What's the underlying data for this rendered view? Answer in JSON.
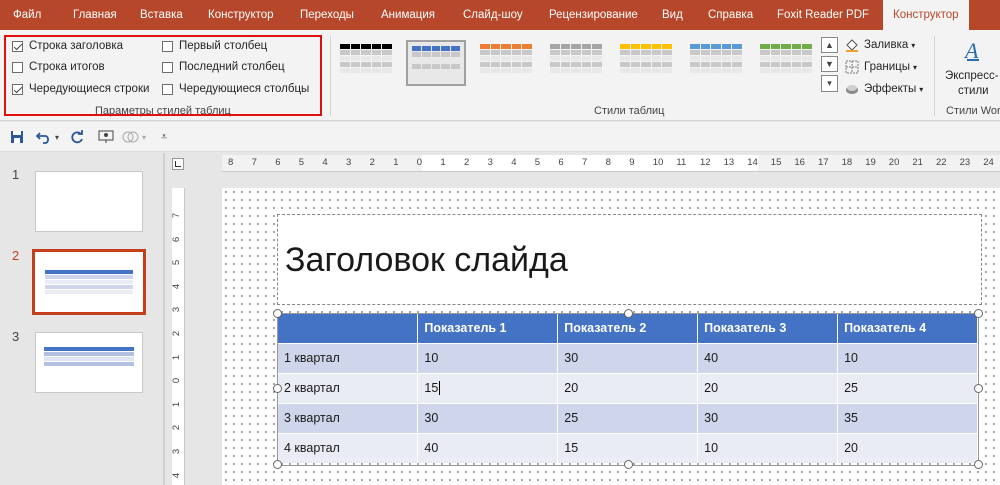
{
  "ribbon_tabs": [
    "Файл",
    "Главная",
    "Вставка",
    "Конструктор",
    "Переходы",
    "Анимация",
    "Слайд-шоу",
    "Рецензирование",
    "Вид",
    "Справка",
    "Foxit Reader PDF",
    "Конструктор"
  ],
  "active_tab_index": 11,
  "table_style_options": {
    "group_label": "Параметры стилей таблиц",
    "options": [
      {
        "label": "Строка заголовка",
        "checked": true
      },
      {
        "label": "Строка итогов",
        "checked": false
      },
      {
        "label": "Чередующиеся строки",
        "checked": true
      },
      {
        "label": "Первый столбец",
        "checked": false
      },
      {
        "label": "Последний столбец",
        "checked": false
      },
      {
        "label": "Чередующиеся столбцы",
        "checked": false
      }
    ]
  },
  "table_styles": {
    "group_label": "Стили таблиц",
    "thumb_colors": [
      "#000000",
      "#4472c4",
      "#ed7d31",
      "#a5a5a5",
      "#ffc000",
      "#5b9bd5",
      "#70ad47"
    ],
    "selected_index": 1
  },
  "shading": {
    "fill_label": "Заливка",
    "borders_label": "Границы",
    "effects_label": "Эффекты"
  },
  "wordart": {
    "express_label": "Экспресс-",
    "express_label2": "стили",
    "group_label": "Стили Wor"
  },
  "ruler_h_labels": [
    "8",
    "7",
    "6",
    "5",
    "4",
    "3",
    "2",
    "1",
    "0",
    "1",
    "2",
    "3",
    "4",
    "5",
    "6",
    "7",
    "8",
    "9",
    "10",
    "11",
    "12",
    "13",
    "14",
    "15",
    "16",
    "17",
    "18",
    "19",
    "20",
    "21",
    "22",
    "23",
    "24"
  ],
  "ruler_v_labels": [
    "7",
    "6",
    "5",
    "4",
    "3",
    "2",
    "1",
    "0",
    "1",
    "2",
    "3",
    "4"
  ],
  "thumbnails": [
    {
      "number": "1",
      "active": false
    },
    {
      "number": "2",
      "active": true
    },
    {
      "number": "3",
      "active": false
    }
  ],
  "slide": {
    "title": "Заголовок слайда",
    "table": {
      "headers": [
        "",
        "Показатель 1",
        "Показатель 2",
        "Показатель 3",
        "Показатель 4"
      ],
      "rows": [
        [
          "1 квартал",
          "10",
          "30",
          "40",
          "10"
        ],
        [
          "2 квартал",
          "15",
          "20",
          "20",
          "25"
        ],
        [
          "3 квартал",
          "30",
          "25",
          "30",
          "35"
        ],
        [
          "4 квартал",
          "40",
          "15",
          "10",
          "20"
        ]
      ]
    }
  },
  "colors": {
    "accent": "#b7472a",
    "table_header": "#4472c4",
    "band_dark": "#cfd5ea",
    "band_light": "#e9ebf5",
    "highlight": "#e01010"
  }
}
